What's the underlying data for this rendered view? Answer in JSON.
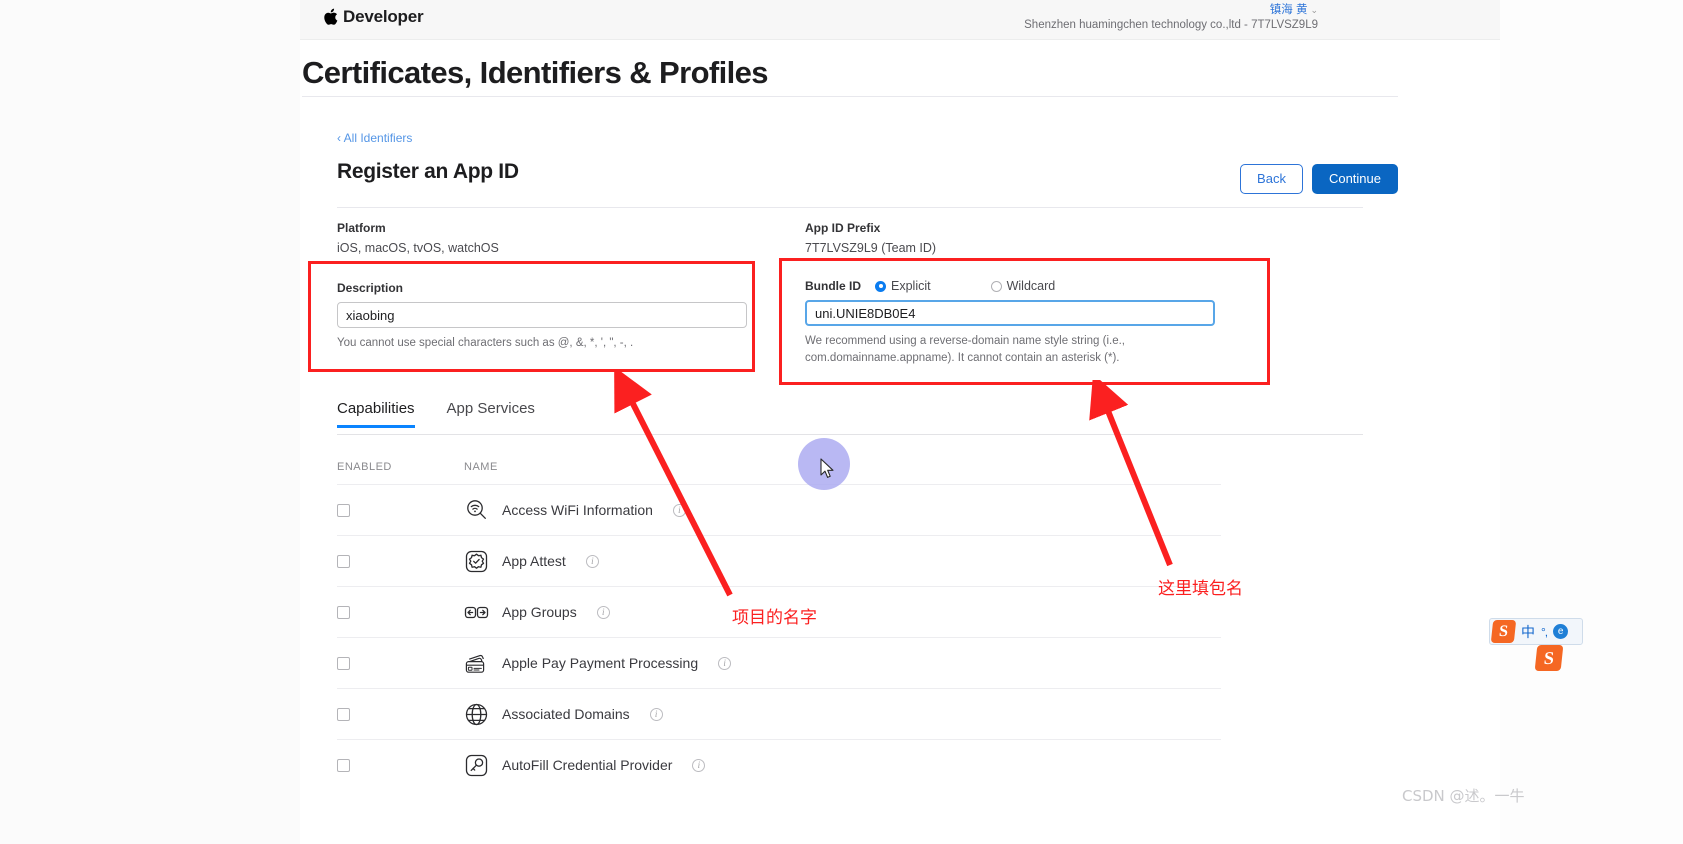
{
  "globalnav": {
    "brand": "Developer",
    "user_name": "镇海 黄",
    "team": "Shenzhen huamingchen technology co.,ltd - 7T7LVSZ9L9"
  },
  "page": {
    "title": "Certificates, Identifiers & Profiles",
    "breadcrumb": "‹ All Identifiers",
    "section_title": "Register an App ID"
  },
  "actions": {
    "back_label": "Back",
    "continue_label": "Continue"
  },
  "form": {
    "platform_label": "Platform",
    "platform_value": "iOS, macOS, tvOS, watchOS",
    "app_id_prefix_label": "App ID Prefix",
    "app_id_prefix_value": "7T7LVSZ9L9 (Team ID)",
    "description_label": "Description",
    "description_value": "xiaobing",
    "description_placeholder": "",
    "description_hint": "You cannot use special characters such as @, &, *, ', \", -, .",
    "bundle_id_label": "Bundle ID",
    "bundle_option_explicit": "Explicit",
    "bundle_option_wildcard": "Wildcard",
    "bundle_id_value": "uni.UNIE8DB0E4",
    "bundle_id_placeholder": "",
    "bundle_id_hint": "We recommend using a reverse-domain name style string (i.e., com.domainname.appname). It cannot contain an asterisk (*)."
  },
  "tabs": [
    {
      "label": "Capabilities",
      "active": true
    },
    {
      "label": "App Services",
      "active": false
    }
  ],
  "capabilities_table": {
    "columns": [
      "ENABLED",
      "NAME"
    ],
    "rows": [
      {
        "name": "Access WiFi Information",
        "icon": "wifi-search-icon",
        "enabled": false
      },
      {
        "name": "App Attest",
        "icon": "attest-badge-icon",
        "enabled": false
      },
      {
        "name": "App Groups",
        "icon": "app-groups-icon",
        "enabled": false
      },
      {
        "name": "Apple Pay Payment Processing",
        "icon": "apple-pay-icon",
        "enabled": false
      },
      {
        "name": "Associated Domains",
        "icon": "globe-icon",
        "enabled": false
      },
      {
        "name": "AutoFill Credential Provider",
        "icon": "key-icon",
        "enabled": false
      }
    ]
  },
  "annotations": {
    "left_text": "项目的名字",
    "right_text": "这里填包名",
    "color": "#fb2020"
  },
  "ime": {
    "logo": "S",
    "mode": "中",
    "punctuation": "°,",
    "logo2": "S"
  },
  "watermark": "CSDN @述。一牛",
  "colors": {
    "accent_blue": "#0a66c2",
    "link_blue": "#2d74d8",
    "tab_underline": "#0a84ff",
    "annotation_red": "#fb2020"
  }
}
